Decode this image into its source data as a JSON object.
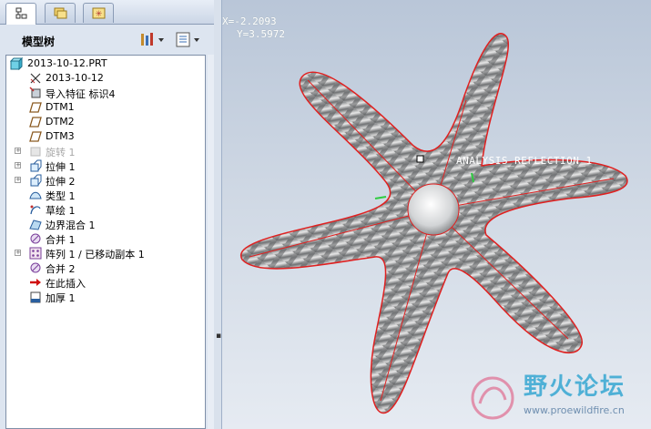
{
  "tabs": [
    {
      "name": "model-tree-tab",
      "icon": "tree-icon",
      "active": true
    },
    {
      "name": "folder-browser-tab",
      "icon": "folder-icon",
      "active": false
    },
    {
      "name": "favorites-tab",
      "icon": "favorites-icon",
      "active": false
    }
  ],
  "tree": {
    "title": "模型树",
    "settings_icon": "tree-settings-icon",
    "show_icon": "show-columns-icon",
    "root": "2013-10-12.PRT",
    "items": [
      {
        "label": "2013-10-12",
        "icon": "csys-icon",
        "expand": false,
        "dim": false
      },
      {
        "label": "导入特征 标识4",
        "icon": "import-feature-icon",
        "expand": false,
        "dim": false
      },
      {
        "label": "DTM1",
        "icon": "datum-plane-icon",
        "expand": false,
        "dim": false
      },
      {
        "label": "DTM2",
        "icon": "datum-plane-icon",
        "expand": false,
        "dim": false
      },
      {
        "label": "DTM3",
        "icon": "datum-plane-icon",
        "expand": false,
        "dim": false
      },
      {
        "label": "旋转 1",
        "icon": "revolve-icon",
        "expand": true,
        "dim": true
      },
      {
        "label": "拉伸 1",
        "icon": "extrude-icon",
        "expand": true,
        "dim": false
      },
      {
        "label": "拉伸 2",
        "icon": "extrude-icon",
        "expand": true,
        "dim": false
      },
      {
        "label": "类型 1",
        "icon": "style-surface-icon",
        "expand": false,
        "dim": false
      },
      {
        "label": "草绘 1",
        "icon": "sketch-icon",
        "expand": false,
        "dim": false
      },
      {
        "label": "边界混合 1",
        "icon": "boundary-blend-icon",
        "expand": false,
        "dim": false
      },
      {
        "label": "合并 1",
        "icon": "merge-icon",
        "expand": false,
        "dim": false
      },
      {
        "label": "阵列 1 / 已移动副本 1",
        "icon": "pattern-icon",
        "expand": true,
        "dim": false
      },
      {
        "label": "合并 2",
        "icon": "merge-icon",
        "expand": false,
        "dim": false
      },
      {
        "label": "在此插入",
        "icon": "insert-here-arrow-icon",
        "expand": false,
        "dim": false
      },
      {
        "label": "加厚 1",
        "icon": "thicken-icon",
        "expand": false,
        "dim": false
      }
    ]
  },
  "viewport": {
    "coord_x": "X=-2.2093",
    "coord_y": "Y=3.5972",
    "analysis_label": "ANALYSIS_REFLECTION_1",
    "model": "six-arm-star-surface",
    "edge_color": "#e02020",
    "surface_color": "#a8aaac"
  },
  "watermark": {
    "title": "野火论坛",
    "url": "www.proewildfire.cn",
    "color": "#4fb0d6"
  }
}
